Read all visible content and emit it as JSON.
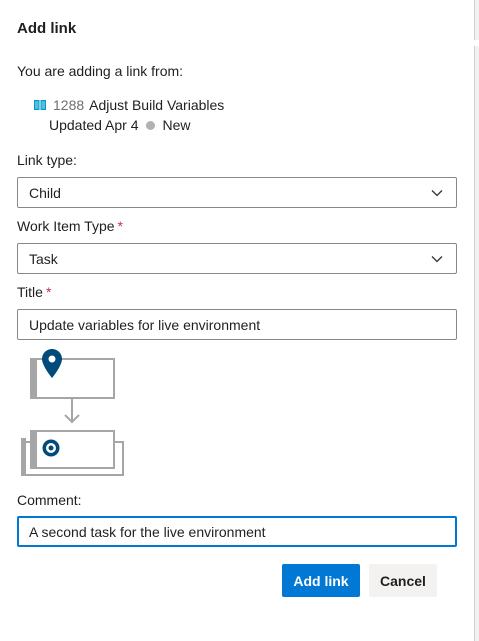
{
  "dialog": {
    "title": "Add link",
    "intro": "You are adding a link from:"
  },
  "source_item": {
    "icon": "book-icon",
    "id": "1288",
    "name": "Adjust Build Variables",
    "updated": "Updated Apr 4",
    "state": "New",
    "state_color": "#b2b2b2",
    "icon_color": "#009ccc"
  },
  "link_type": {
    "label": "Link type:",
    "value": "Child"
  },
  "work_item_type": {
    "label": "Work Item Type",
    "required_mark": "*",
    "value": "Task"
  },
  "title_field": {
    "label": "Title",
    "required_mark": "*",
    "value": "Update variables for live environment"
  },
  "comment": {
    "label": "Comment:",
    "value": "A second task for the live environment"
  },
  "buttons": {
    "primary": "Add link",
    "secondary": "Cancel"
  },
  "colors": {
    "accent": "#0078d4",
    "required": "#c4314b",
    "graphic_dark": "#004b7a"
  }
}
